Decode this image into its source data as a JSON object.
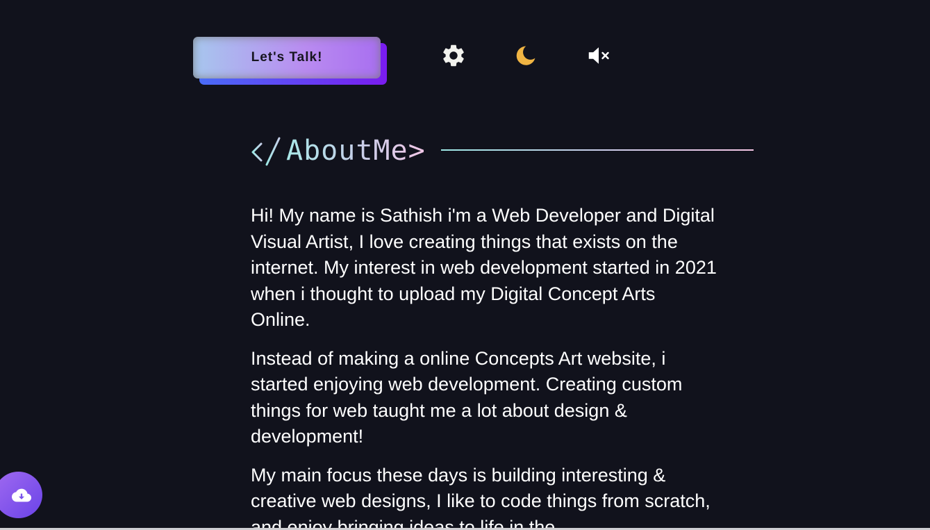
{
  "header": {
    "cta_label": "Let's Talk!",
    "icons": {
      "settings": "gear-icon",
      "theme": "moon-icon",
      "sound": "speaker-muted-icon"
    }
  },
  "about": {
    "title": "AboutMe>",
    "title_icon": "code-slash-icon",
    "paragraphs": [
      "Hi! My name is Sathish i'm a Web Developer and Digital Visual Artist, I love creating things that exists on the internet. My interest in web development started in 2021 when i thought to upload my Digital Concept Arts Online.",
      "Instead of making a online Concepts Art website, i started enjoying web development. Creating custom things for web taught me a lot about design & development!",
      "My main focus these days is building interesting & creative web designs, I like to code things from scratch, and enjoy bringing ideas to life in the"
    ]
  },
  "floating": {
    "download_icon": "cloud-download-icon"
  },
  "colors": {
    "background": "#11121c",
    "cta_gradient_start": "#a7c7ee",
    "cta_gradient_end": "#a86ff0",
    "cta_shadow_start": "#4a6cf7",
    "cta_shadow_end": "#7a1cf0",
    "moon": "#f0b443",
    "heading_gradient_start": "#a9e8e8",
    "heading_gradient_end": "#f1c6e6",
    "download_button": "#8a5cf0"
  }
}
